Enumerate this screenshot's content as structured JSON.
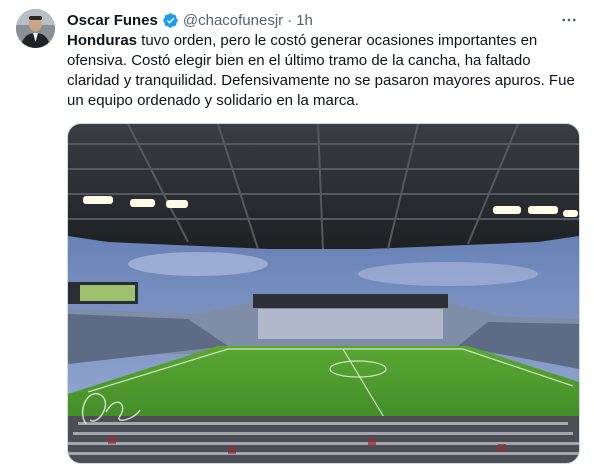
{
  "author": {
    "name": "Oscar Funes",
    "handle": "@chacofunesjr",
    "separator": "·",
    "time": "1h"
  },
  "tweet": {
    "bold_lead": "Honduras",
    "text_rest": " tuvo orden, pero le costó generar ocasiones importantes en ofensiva. Costó elegir bien en el último tramo de la cancha, ha faltado claridad y tranquilidad. Defensivamente no se pasaron mayores apuros. Fue un equipo ordenado y solidario en la marca."
  },
  "icons": {
    "verified": "verified-badge-icon",
    "more": "more-options-icon"
  },
  "colors": {
    "verified_blue": "#1d9bf0",
    "muted_text": "#536471",
    "pitch_green": "#4f9a2e"
  }
}
